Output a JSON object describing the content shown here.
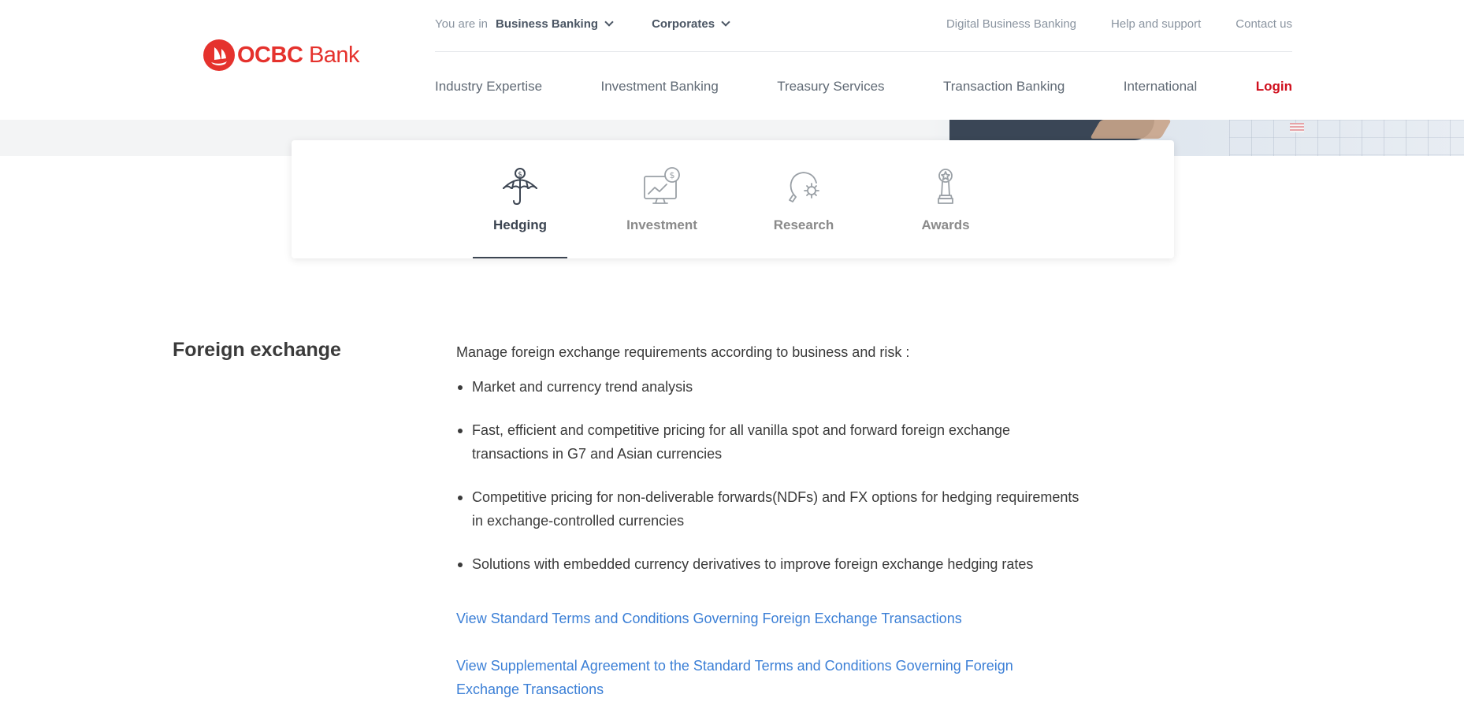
{
  "brand": {
    "name_bold": "OCBC",
    "name_rest": "Bank",
    "color": "#e5322d"
  },
  "topbar": {
    "you_are_in": "You are in",
    "segment": "Business Banking",
    "sub_segment": "Corporates",
    "links": [
      "Digital Business Banking",
      "Help and support",
      "Contact us"
    ]
  },
  "nav": {
    "items": [
      "Industry Expertise",
      "Investment Banking",
      "Treasury Services",
      "Transaction Banking",
      "International"
    ],
    "login": "Login",
    "login_color": "#d0101e"
  },
  "tabs": [
    {
      "label": "Hedging",
      "icon": "umbrella-dollar-icon",
      "active": true
    },
    {
      "label": "Investment",
      "icon": "monitor-chart-icon",
      "active": false
    },
    {
      "label": "Research",
      "icon": "lightbulb-gear-icon",
      "active": false
    },
    {
      "label": "Awards",
      "icon": "trophy-icon",
      "active": false
    }
  ],
  "section": {
    "title": "Foreign exchange",
    "intro": "Manage foreign exchange requirements according to business and risk :",
    "bullets": [
      "Market and currency trend analysis",
      "Fast, efficient and competitive pricing for all vanilla spot and forward foreign exchange transactions in G7 and Asian currencies",
      "Competitive pricing for non-deliverable forwards(NDFs) and FX options for hedging requirements in exchange-controlled currencies",
      "Solutions with embedded currency derivatives to improve foreign exchange hedging rates"
    ],
    "links": [
      "View Standard Terms and Conditions Governing Foreign Exchange Transactions",
      "View Supplemental Agreement to the Standard Terms and Conditions Governing Foreign Exchange Transactions"
    ],
    "link_color": "#3b7fd6"
  }
}
